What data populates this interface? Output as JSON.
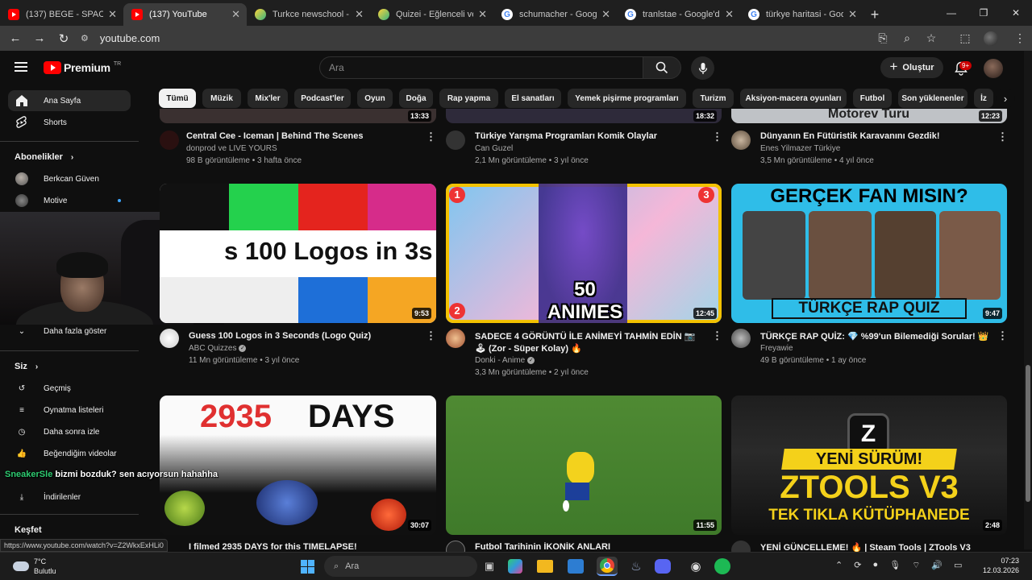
{
  "browser": {
    "tabs": [
      {
        "favicon": "youtube-icon",
        "title": "(137) BEGE - SPACEJ..."
      },
      {
        "favicon": "youtube-icon",
        "title": "(137) YouTube"
      },
      {
        "favicon": "quizizz-icon",
        "title": "Turkce newschool - T"
      },
      {
        "favicon": "quizizz-icon",
        "title": "Quizei - Eğlenceli ve"
      },
      {
        "favicon": "google-icon",
        "title": "schumacher - Google"
      },
      {
        "favicon": "google-icon",
        "title": "tranlstae - Google'da"
      },
      {
        "favicon": "google-icon",
        "title": "türkye haritasi - Goo"
      }
    ],
    "active_tab": 1,
    "url": "youtube.com",
    "status_url": "https://www.youtube.com/watch?v=Z2WkxExHLi0"
  },
  "youtube": {
    "logo_word": "Premium",
    "logo_country": "TR",
    "search_placeholder": "Ara",
    "create_label": "Oluştur",
    "notif_count": "9+"
  },
  "sidebar": {
    "home": "Ana Sayfa",
    "shorts": "Shorts",
    "subs_header": "Abonelikler",
    "subs": [
      "Berkcan Güven",
      "Motive"
    ],
    "show_more": "Daha fazla göster",
    "you_header": "Siz",
    "you_items": [
      "Geçmiş",
      "Oynatma listeleri",
      "Daha sonra izle",
      "Beğendiğim videolar",
      "İndirilenler"
    ],
    "explore_header": "Keşfet"
  },
  "chips": [
    "Tümü",
    "Müzik",
    "Mix'ler",
    "Podcast'ler",
    "Oyun",
    "Doğa",
    "Rap yapma",
    "El sanatları",
    "Yemek pişirme programları",
    "Turizm",
    "Aksiyon-macera oyunları",
    "Futbol",
    "Son yüklenenler",
    "İz"
  ],
  "videos": [
    {
      "title": "Central Cee - Iceman | Behind The Scenes",
      "channel": "donprod ve LIVE YOURS",
      "meta": "98 B görüntüleme • 3 hafta önce",
      "duration": "13:33"
    },
    {
      "title": "Türkiye Yarışma Programları Komik Olaylar",
      "channel": "Can Guzel",
      "meta": "2,1 Mn görüntüleme • 3 yıl önce",
      "duration": "18:32"
    },
    {
      "title": "Dünyanın En Fütüristik Karavanını Gezdik!",
      "channel": "Enes Yilmazer Türkiye",
      "meta": "3,5 Mn görüntüleme • 4 yıl önce",
      "duration": "12:23",
      "thumb_text": "Motorev Turu"
    },
    {
      "title": "Guess 100 Logos in 3 Seconds (Logo Quiz)",
      "channel": "ABC Quizzes",
      "meta": "11 Mn görüntüleme • 3 yıl önce",
      "duration": "9:53",
      "thumb_text": "s 100 Logos in 3s"
    },
    {
      "title": "SADECE 4 GÖRÜNTÜ İLE ANİMEYİ TAHMİN EDİN 📷",
      "title2": "🕹 (Zor - Süper Kolay) 🔥",
      "channel": "Donki - Anime",
      "meta": "3,3 Mn görüntüleme • 2 yıl önce",
      "duration": "12:45",
      "thumb_text": "50 ANIMES",
      "thumb_nums": [
        "1",
        "2",
        "3"
      ]
    },
    {
      "title": "TÜRKÇE RAP QUİZ: 💎 %99'un Bilemediği Sorular! 👑",
      "channel": "Freyawie",
      "meta": "49 B görüntüleme • 1 ay önce",
      "duration": "9:47",
      "thumb_top": "GERÇEK FAN MISIN?",
      "thumb_bottom": "TÜRKÇE RAP QUIZ"
    },
    {
      "title": "I filmed 2935 DAYS for this TIMELAPSE!",
      "duration": "30:07",
      "thumb_num": "2935",
      "thumb_word": "DAYS"
    },
    {
      "title": "Futbol Tarihinin İKONİK ANLARI",
      "duration": "11:55"
    },
    {
      "title": "YENİ GÜNCELLEME! 🔥 | Steam Tools | ZTools V3",
      "duration": "2:48",
      "thumb_top": "YENİ SÜRÜM!",
      "thumb_mid": "ZTOOLS V3",
      "thumb_bottom": "TEK TIKLA KÜTÜPHANEDE"
    }
  ],
  "chat": {
    "user": "SneakerSle",
    "message": "bizmi bozduk? sen acıyorsun hahahha"
  },
  "taskbar": {
    "temp": "7°C",
    "weather": "Bulutlu",
    "search": "Ara",
    "time": "07:23",
    "date": "12.03.2026"
  },
  "colors": {
    "yt_red": "#ff0000",
    "bg": "#0f0f0f",
    "chip": "#272727"
  }
}
